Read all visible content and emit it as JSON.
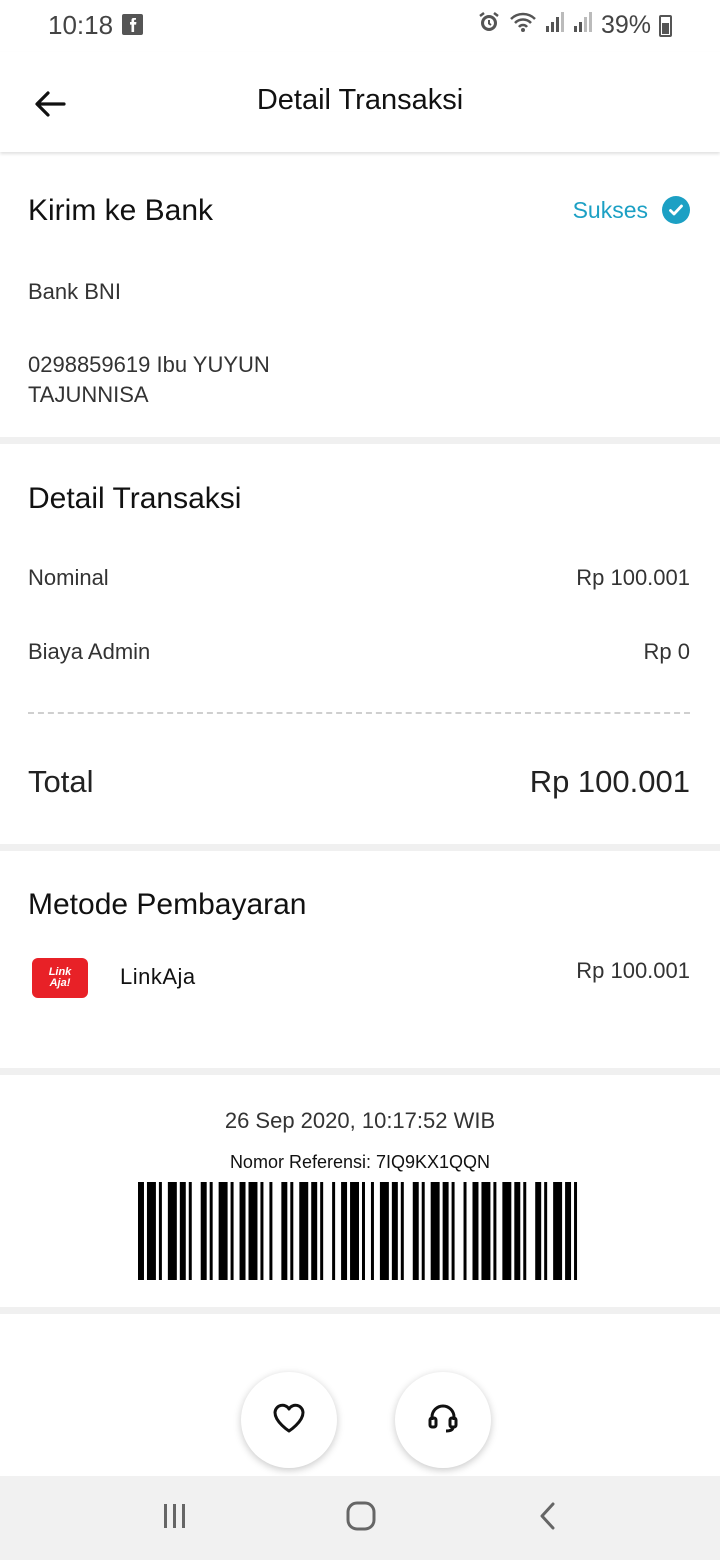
{
  "status_bar": {
    "time": "10:18",
    "battery": "39%"
  },
  "header": {
    "title": "Detail Transaksi"
  },
  "transfer": {
    "title": "Kirim ke Bank",
    "status": "Sukses",
    "bank": "Bank BNI",
    "account_line1": "0298859619 Ibu YUYUN",
    "account_line2": "TAJUNNISA"
  },
  "details": {
    "title": "Detail Transaksi",
    "nominal_label": "Nominal",
    "nominal_value": "Rp 100.001",
    "admin_label": "Biaya Admin",
    "admin_value": "Rp 0",
    "total_label": "Total",
    "total_value": "Rp 100.001"
  },
  "payment": {
    "title": "Metode Pembayaran",
    "logo_line1": "Link",
    "logo_line2": "Aja!",
    "method": "LinkAja",
    "amount": "Rp 100.001"
  },
  "receipt": {
    "datetime": "26 Sep 2020, 10:17:52 WIB",
    "reference": "Nomor Referensi: 7IQ9KX1QQN"
  },
  "colors": {
    "accent": "#1ca0c4",
    "linkaja_red": "#e82127"
  },
  "icons": {
    "back": "arrow-left-icon",
    "status": "check-circle-icon",
    "favorite": "heart-icon",
    "support": "headset-icon"
  }
}
